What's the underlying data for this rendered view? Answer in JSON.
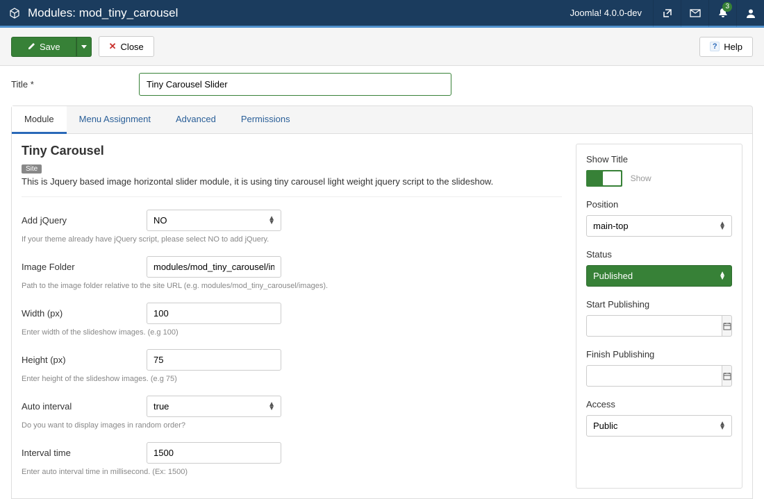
{
  "topbar": {
    "title": "Modules: mod_tiny_carousel",
    "version": "Joomla! 4.0.0-dev",
    "notify_count": "3"
  },
  "toolbar": {
    "save": "Save",
    "close": "Close",
    "help": "Help"
  },
  "title": {
    "label": "Title *",
    "value": "Tiny Carousel Slider"
  },
  "tabs": [
    "Module",
    "Menu Assignment",
    "Advanced",
    "Permissions"
  ],
  "module": {
    "heading": "Tiny Carousel",
    "badge": "Site",
    "desc": "This is Jquery based image horizontal slider module, it is using tiny carousel light weight jquery script to the slideshow.",
    "fields": {
      "add_jquery": {
        "label": "Add jQuery",
        "value": "NO",
        "hint": "If your theme already have jQuery script, please select NO to add jQuery."
      },
      "image_folder": {
        "label": "Image Folder",
        "value": "modules/mod_tiny_carousel/image",
        "hint": "Path to the image folder relative to the site URL (e.g. modules/mod_tiny_carousel/images)."
      },
      "width": {
        "label": "Width (px)",
        "value": "100",
        "hint": "Enter width of the slideshow images. (e.g 100)"
      },
      "height": {
        "label": "Height (px)",
        "value": "75",
        "hint": "Enter height of the slideshow images. (e.g 75)"
      },
      "auto_interval": {
        "label": "Auto interval",
        "value": "true",
        "hint": "Do you want to display images in random order?"
      },
      "interval_time": {
        "label": "Interval time",
        "value": "1500",
        "hint": "Enter auto interval time in millisecond. (Ex: 1500)"
      }
    }
  },
  "side": {
    "show_title": {
      "label": "Show Title",
      "text": "Show"
    },
    "position": {
      "label": "Position",
      "value": "main-top"
    },
    "status": {
      "label": "Status",
      "value": "Published"
    },
    "start_pub": {
      "label": "Start Publishing",
      "value": ""
    },
    "finish_pub": {
      "label": "Finish Publishing",
      "value": ""
    },
    "access": {
      "label": "Access",
      "value": "Public"
    }
  }
}
